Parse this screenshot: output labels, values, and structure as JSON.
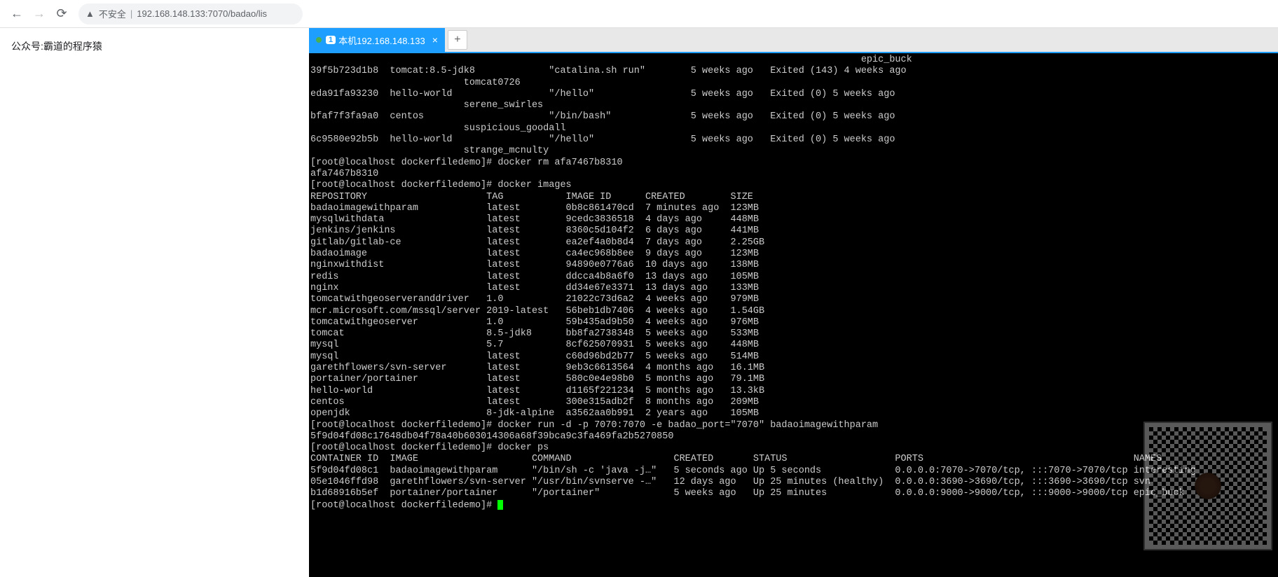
{
  "browser": {
    "insecure_label": "不安全",
    "url": "192.168.148.133:7070/badao/lis"
  },
  "page_text": "公众号:霸道的程序猿",
  "terminal_tab": {
    "number": "1",
    "title": "本机192.168.148.133"
  },
  "containers_partial": [
    {
      "id": "",
      "image": "",
      "name": "epic_buck",
      "command": "",
      "created": "",
      "status": ""
    },
    {
      "id": "39f5b723d1b8",
      "image": "tomcat:8.5-jdk8",
      "name": "tomcat0726",
      "command": "\"catalina.sh run\"",
      "created": "5 weeks ago",
      "status": "Exited (143) 4 weeks ago"
    },
    {
      "id": "eda91fa93230",
      "image": "hello-world",
      "name": "serene_swirles",
      "command": "\"/hello\"",
      "created": "5 weeks ago",
      "status": "Exited (0) 5 weeks ago"
    },
    {
      "id": "bfaf7f3fa9a0",
      "image": "centos",
      "name": "suspicious_goodall",
      "command": "\"/bin/bash\"",
      "created": "5 weeks ago",
      "status": "Exited (0) 5 weeks ago"
    },
    {
      "id": "6c9580e92b5b",
      "image": "hello-world",
      "name": "strange_mcnulty",
      "command": "\"/hello\"",
      "created": "5 weeks ago",
      "status": "Exited (0) 5 weeks ago"
    }
  ],
  "prompt_base": "[root@localhost dockerfiledemo]#",
  "cmd_rm": "docker rm afa7467b8310",
  "rm_output": "afa7467b8310",
  "cmd_images": "docker images",
  "images_header": {
    "repo": "REPOSITORY",
    "tag": "TAG",
    "image_id": "IMAGE ID",
    "created": "CREATED",
    "size": "SIZE"
  },
  "images": [
    {
      "repo": "badaoimagewithparam",
      "tag": "latest",
      "id": "0b8c861470cd",
      "created": "7 minutes ago",
      "size": "123MB"
    },
    {
      "repo": "mysqlwithdata",
      "tag": "latest",
      "id": "9cedc3836518",
      "created": "4 days ago",
      "size": "448MB"
    },
    {
      "repo": "jenkins/jenkins",
      "tag": "latest",
      "id": "8360c5d104f2",
      "created": "6 days ago",
      "size": "441MB"
    },
    {
      "repo": "gitlab/gitlab-ce",
      "tag": "latest",
      "id": "ea2ef4a0b8d4",
      "created": "7 days ago",
      "size": "2.25GB"
    },
    {
      "repo": "badaoimage",
      "tag": "latest",
      "id": "ca4ec968b8ee",
      "created": "9 days ago",
      "size": "123MB"
    },
    {
      "repo": "nginxwithdist",
      "tag": "latest",
      "id": "94890e0776a6",
      "created": "10 days ago",
      "size": "138MB"
    },
    {
      "repo": "redis",
      "tag": "latest",
      "id": "ddcca4b8a6f0",
      "created": "13 days ago",
      "size": "105MB"
    },
    {
      "repo": "nginx",
      "tag": "latest",
      "id": "dd34e67e3371",
      "created": "13 days ago",
      "size": "133MB"
    },
    {
      "repo": "tomcatwithgeoserveranddriver",
      "tag": "1.0",
      "id": "21022c73d6a2",
      "created": "4 weeks ago",
      "size": "979MB"
    },
    {
      "repo": "mcr.microsoft.com/mssql/server",
      "tag": "2019-latest",
      "id": "56beb1db7406",
      "created": "4 weeks ago",
      "size": "1.54GB"
    },
    {
      "repo": "tomcatwithgeoserver",
      "tag": "1.0",
      "id": "59b435ad9b50",
      "created": "4 weeks ago",
      "size": "976MB"
    },
    {
      "repo": "tomcat",
      "tag": "8.5-jdk8",
      "id": "bb8fa2738348",
      "created": "5 weeks ago",
      "size": "533MB"
    },
    {
      "repo": "mysql",
      "tag": "5.7",
      "id": "8cf625070931",
      "created": "5 weeks ago",
      "size": "448MB"
    },
    {
      "repo": "mysql",
      "tag": "latest",
      "id": "c60d96bd2b77",
      "created": "5 weeks ago",
      "size": "514MB"
    },
    {
      "repo": "garethflowers/svn-server",
      "tag": "latest",
      "id": "9eb3c6613564",
      "created": "4 months ago",
      "size": "16.1MB"
    },
    {
      "repo": "portainer/portainer",
      "tag": "latest",
      "id": "580c0e4e98b0",
      "created": "5 months ago",
      "size": "79.1MB"
    },
    {
      "repo": "hello-world",
      "tag": "latest",
      "id": "d1165f221234",
      "created": "5 months ago",
      "size": "13.3kB"
    },
    {
      "repo": "centos",
      "tag": "latest",
      "id": "300e315adb2f",
      "created": "8 months ago",
      "size": "209MB"
    },
    {
      "repo": "openjdk",
      "tag": "8-jdk-alpine",
      "id": "a3562aa0b991",
      "created": "2 years ago",
      "size": "105MB"
    }
  ],
  "cmd_run": "docker run -d -p 7070:7070 -e badao_port=\"7070\" badaoimagewithparam",
  "run_output": "5f9d04fd08c17648db04f78a40b603014306a68f39bca9c3fa469fa2b5270850",
  "cmd_ps": "docker ps",
  "ps_header": {
    "id": "CONTAINER ID",
    "image": "IMAGE",
    "command": "COMMAND",
    "created": "CREATED",
    "status": "STATUS",
    "ports": "PORTS",
    "names": "NAMES"
  },
  "ps_rows": [
    {
      "id": "5f9d04fd08c1",
      "image": "badaoimagewithparam",
      "command": "\"/bin/sh -c 'java -j…\"",
      "created": "5 seconds ago",
      "status": "Up 5 seconds",
      "ports": "0.0.0.0:7070->7070/tcp, :::7070->7070/tcp",
      "names": "interesting"
    },
    {
      "id": "05e1046ffd98",
      "image": "garethflowers/svn-server",
      "command": "\"/usr/bin/svnserve -…\"",
      "created": "12 days ago",
      "status": "Up 25 minutes (healthy)",
      "ports": "0.0.0.0:3690->3690/tcp, :::3690->3690/tcp",
      "names": "svn"
    },
    {
      "id": "b1d68916b5ef",
      "image": "portainer/portainer",
      "command": "\"/portainer\"",
      "created": "5 weeks ago",
      "status": "Up 25 minutes",
      "ports": "0.0.0.0:9000->9000/tcp, :::9000->9000/tcp",
      "names": "epic_buck"
    }
  ],
  "column_widths": {
    "containers_partial": {
      "id": 14,
      "image": 28,
      "command": 25,
      "created": 14
    },
    "images": {
      "repo": 31,
      "tag": 14,
      "id": 14,
      "created": 15
    },
    "ps": {
      "id": 14,
      "image": 25,
      "command": 25,
      "created": 14,
      "status": 25,
      "ports": 42
    }
  }
}
